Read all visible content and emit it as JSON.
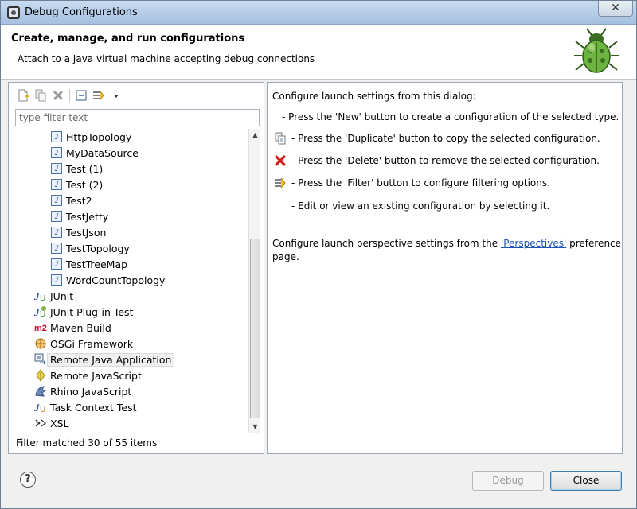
{
  "window": {
    "title": "Debug Configurations",
    "close_glyph": "✕"
  },
  "banner": {
    "title": "Create, manage, and run configurations",
    "subtitle": "Attach to a Java virtual machine accepting debug connections",
    "icon": "bug-icon"
  },
  "left": {
    "toolbar": [
      "new-config-icon",
      "duplicate-icon",
      "delete-icon",
      "collapse-all-icon",
      "filter-icon",
      "dropdown-icon"
    ],
    "filter_placeholder": "type filter text",
    "tree": [
      {
        "label": "HttpTopology",
        "icon": "java-config-icon",
        "indent": 1
      },
      {
        "label": "MyDataSource",
        "icon": "java-config-icon",
        "indent": 1
      },
      {
        "label": "Test (1)",
        "icon": "java-config-icon",
        "indent": 1
      },
      {
        "label": "Test (2)",
        "icon": "java-config-icon",
        "indent": 1
      },
      {
        "label": "Test2",
        "icon": "java-config-icon",
        "indent": 1
      },
      {
        "label": "TestJetty",
        "icon": "java-config-icon",
        "indent": 1
      },
      {
        "label": "TestJson",
        "icon": "java-config-icon",
        "indent": 1
      },
      {
        "label": "TestTopology",
        "icon": "java-config-icon",
        "indent": 1
      },
      {
        "label": "TestTreeMap",
        "icon": "java-config-icon",
        "indent": 1
      },
      {
        "label": "WordCountTopology",
        "icon": "java-config-icon",
        "indent": 1
      },
      {
        "label": "JUnit",
        "icon": "junit-icon",
        "indent": 0
      },
      {
        "label": "JUnit Plug-in Test",
        "icon": "junit-plugin-icon",
        "indent": 0
      },
      {
        "label": "Maven Build",
        "icon": "maven-icon",
        "indent": 0
      },
      {
        "label": "OSGi Framework",
        "icon": "osgi-icon",
        "indent": 0
      },
      {
        "label": "Remote Java Application",
        "icon": "remote-java-icon",
        "indent": 0,
        "selected": true
      },
      {
        "label": "Remote JavaScript",
        "icon": "remote-javascript-icon",
        "indent": 0
      },
      {
        "label": "Rhino JavaScript",
        "icon": "rhino-icon",
        "indent": 0
      },
      {
        "label": "Task Context Test",
        "icon": "task-context-icon",
        "indent": 0
      },
      {
        "label": "XSL",
        "icon": "xsl-icon",
        "indent": 0
      }
    ],
    "filter_status": "Filter matched 30 of 55 items"
  },
  "right": {
    "intro": "Configure launch settings from this dialog:",
    "new_line": "- Press the 'New' button to create a configuration of the selected type.",
    "duplicate_line": "- Press the 'Duplicate' button to copy the selected configuration.",
    "delete_line": "- Press the 'Delete' button to remove the selected configuration.",
    "filter_line": "- Press the 'Filter' button to configure filtering options.",
    "edit_line": "- Edit or view an existing configuration by selecting it.",
    "persp_prefix": "Configure launch perspective settings from the ",
    "persp_link": "'Perspectives'",
    "persp_suffix": " preference",
    "persp_line2": "page."
  },
  "buttons": {
    "help": "?",
    "debug": "Debug",
    "close": "Close"
  }
}
